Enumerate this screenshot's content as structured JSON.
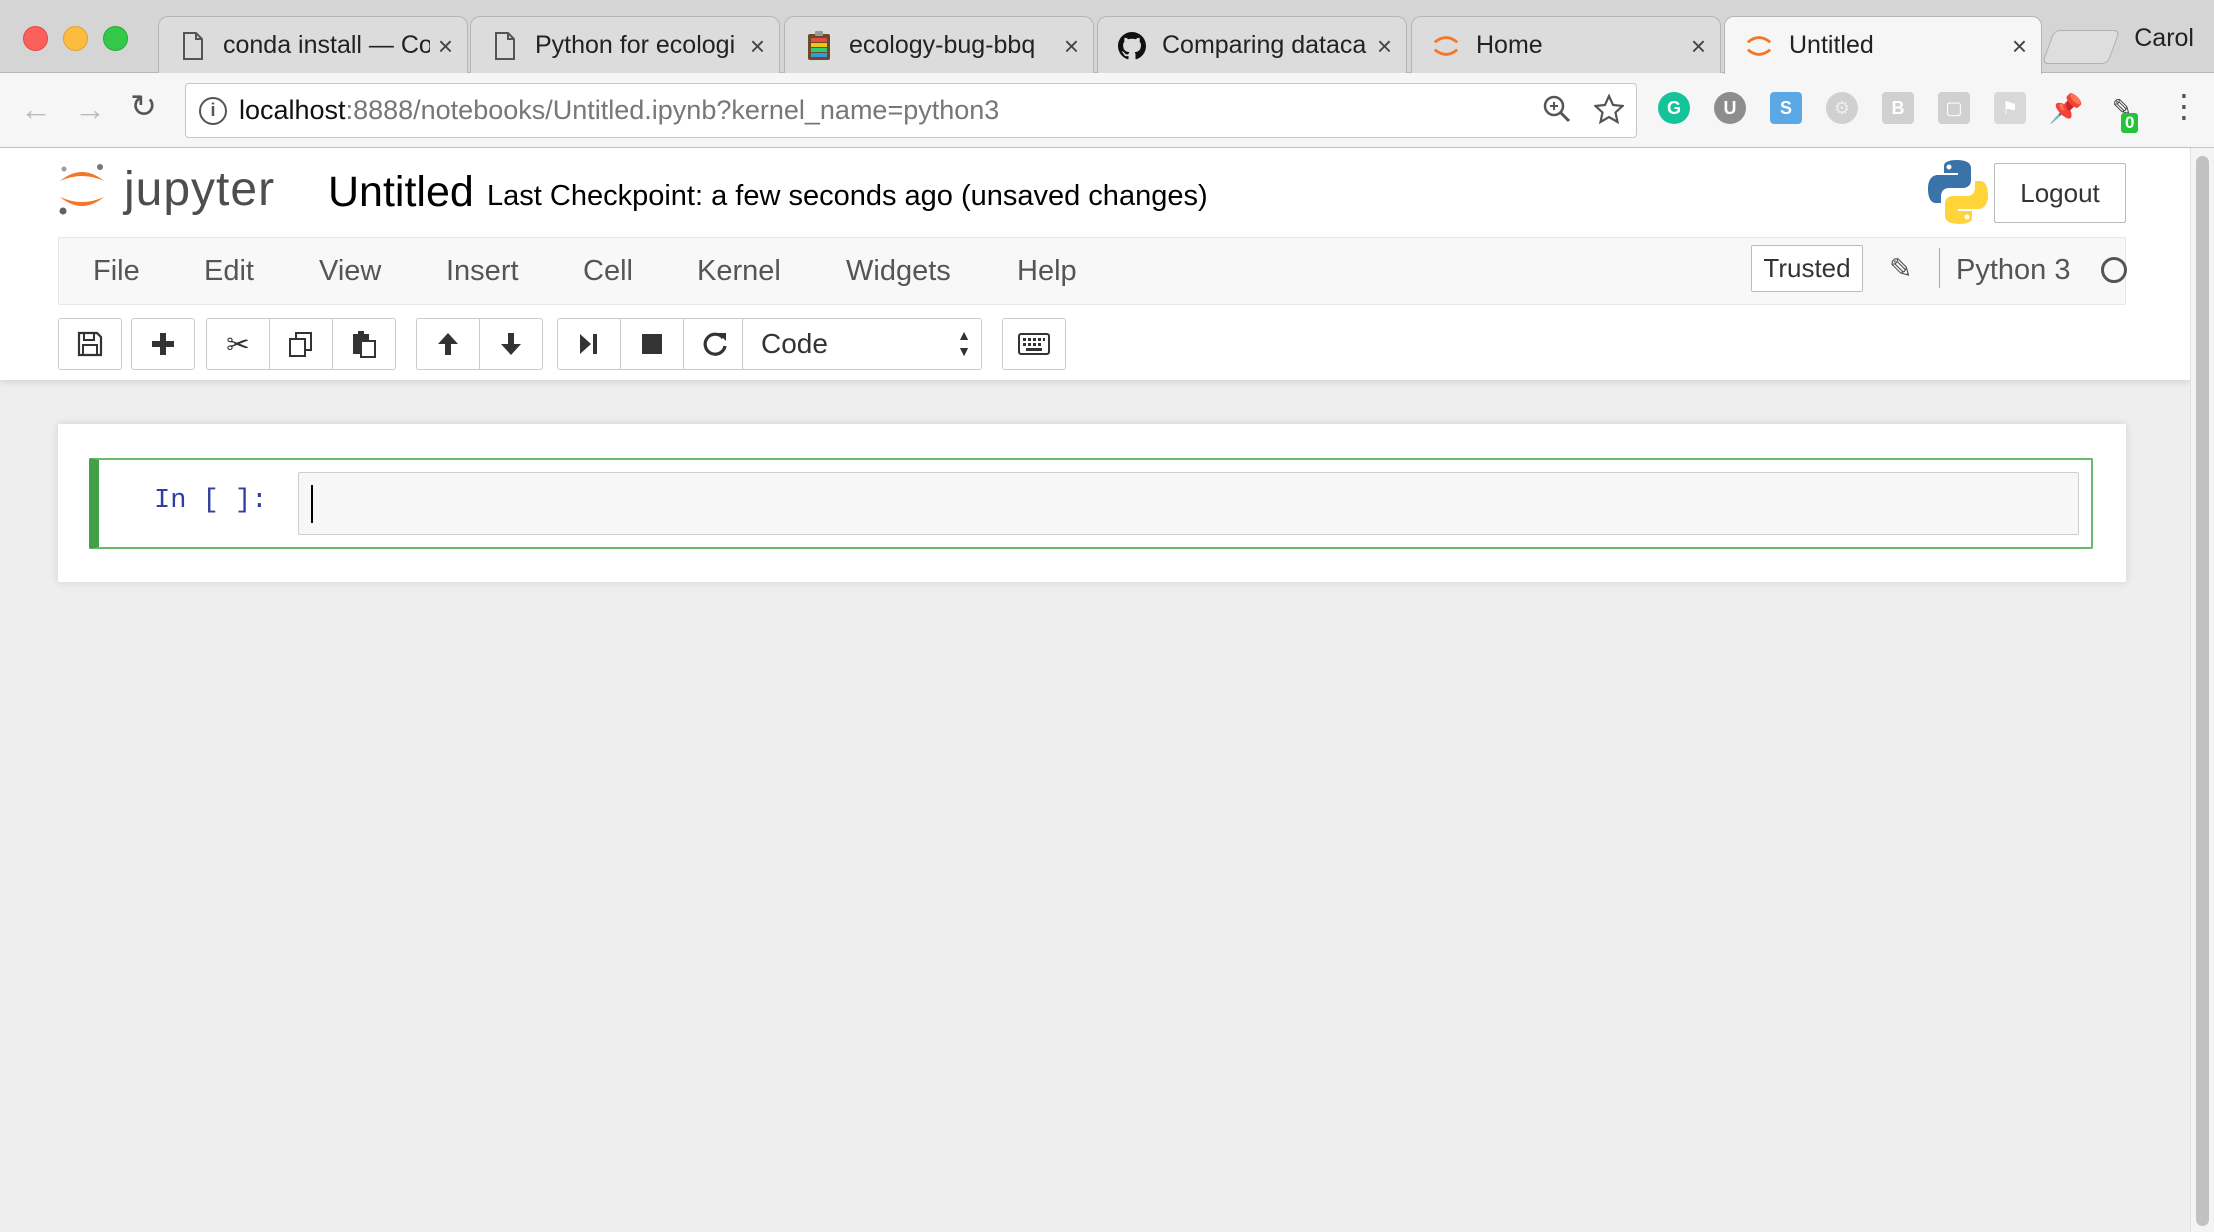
{
  "browser": {
    "tabs": [
      {
        "title": "conda install — Co",
        "icon": "document-icon"
      },
      {
        "title": "Python for ecologi",
        "icon": "document-icon"
      },
      {
        "title": "ecology-bug-bbq",
        "icon": "clipboard-icon"
      },
      {
        "title": "Comparing dataca",
        "icon": "github-icon"
      },
      {
        "title": "Home",
        "icon": "jupyter-icon"
      },
      {
        "title": "Untitled",
        "icon": "jupyter-icon",
        "active": true
      }
    ],
    "close_glyph": "×",
    "profile_name": "Carol",
    "url_host": "localhost",
    "url_rest": ":8888/notebooks/Untitled.ipynb?kernel_name=python3",
    "extension_badge": "0"
  },
  "jupyter": {
    "logo_text": "jupyter",
    "notebook_title": "Untitled",
    "checkpoint": "Last Checkpoint: a few seconds ago (unsaved changes)",
    "logout_label": "Logout",
    "menu": [
      "File",
      "Edit",
      "View",
      "Insert",
      "Cell",
      "Kernel",
      "Widgets",
      "Help"
    ],
    "trusted_label": "Trusted",
    "kernel_name": "Python 3",
    "cell_type": "Code",
    "cell_prompt": "In [ ]:"
  },
  "colors": {
    "jupyter_orange": "#f37726",
    "cell_selected_border": "#66bb6a",
    "prompt_blue": "#303f9f"
  }
}
